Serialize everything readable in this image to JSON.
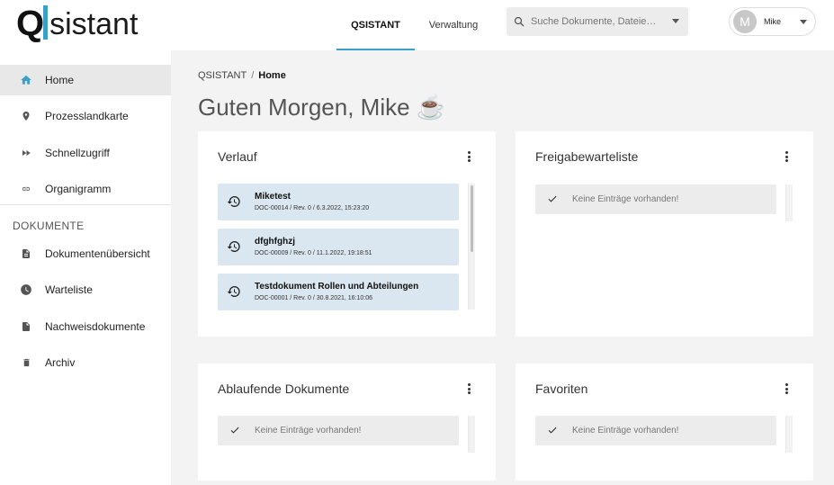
{
  "header": {
    "logo_q": "Q",
    "logo_text": "sistant",
    "tabs": [
      {
        "label": "QSISTANT",
        "active": true
      },
      {
        "label": "Verwaltung",
        "active": false
      }
    ],
    "search": {
      "placeholder": "Suche Dokumente, Dateie…"
    },
    "user": {
      "initial": "M",
      "name": "Mike"
    }
  },
  "sidebar": {
    "items": [
      {
        "label": "Home",
        "icon": "home-icon",
        "active": true
      },
      {
        "label": "Prozesslandkarte",
        "icon": "map-pin-icon"
      },
      {
        "label": "Schnellzugriff",
        "icon": "fast-forward-icon"
      },
      {
        "label": "Organigramm",
        "icon": "link-icon"
      }
    ],
    "section_label": "DOKUMENTE",
    "doc_items": [
      {
        "label": "Dokumentenübersicht",
        "icon": "document-icon"
      },
      {
        "label": "Warteliste",
        "icon": "clock-icon"
      },
      {
        "label": "Nachweisdokumente",
        "icon": "file-icon"
      },
      {
        "label": "Archiv",
        "icon": "trash-icon"
      }
    ]
  },
  "breadcrumb": {
    "root": "QSISTANT",
    "separator": "/",
    "current": "Home"
  },
  "greeting": "Guten Morgen, Mike ☕",
  "cards": {
    "verlauf": {
      "title": "Verlauf",
      "items": [
        {
          "title": "Miketest",
          "meta": "DOC-00014 / Rev. 0 / 6.3.2022, 15:23:20"
        },
        {
          "title": "dfghfghzj",
          "meta": "DOC-00009 / Rev. 0 / 11.1.2022, 19:18:51"
        },
        {
          "title": "Testdokument Rollen und Abteilungen",
          "meta": "DOC-00001 / Rev. 0 / 30.8.2021, 16:10:06"
        }
      ]
    },
    "freigabe": {
      "title": "Freigabewarteliste",
      "empty_text": "Keine Einträge vorhanden!"
    },
    "ablaufend": {
      "title": "Ablaufende Dokumente",
      "empty_text": "Keine Einträge vorhanden!"
    },
    "favoriten": {
      "title": "Favoriten",
      "empty_text": "Keine Einträge vorhanden!"
    }
  },
  "colors": {
    "accent": "#3aa0c9",
    "history_item_bg": "#dbe7f0",
    "empty_item_bg": "#ececec"
  }
}
